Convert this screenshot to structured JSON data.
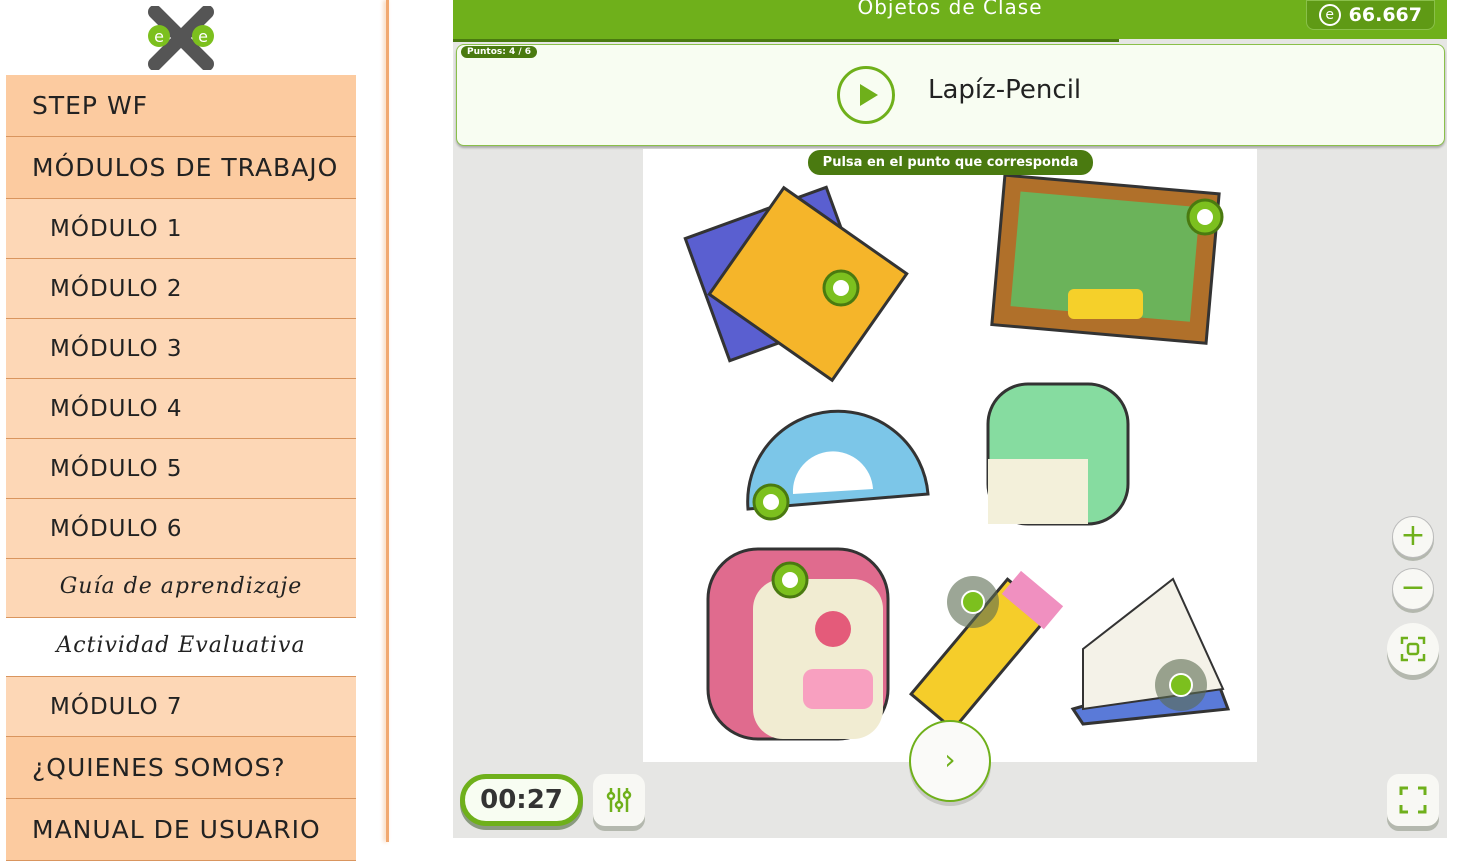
{
  "sidebar": {
    "items": [
      {
        "label": "STEP  WF",
        "kind": "top"
      },
      {
        "label": "MÓDULOS  DE  TRABAJO",
        "kind": "top"
      },
      {
        "label": "MÓDULO  1",
        "kind": "mod"
      },
      {
        "label": "MÓDULO  2",
        "kind": "mod"
      },
      {
        "label": "MÓDULO  3",
        "kind": "mod"
      },
      {
        "label": "MÓDULO  4",
        "kind": "mod"
      },
      {
        "label": "MÓDULO  5",
        "kind": "mod"
      },
      {
        "label": "MÓDULO  6",
        "kind": "mod"
      },
      {
        "label": "Guía  de  aprendizaje",
        "kind": "sub"
      },
      {
        "label": "Actividad  Evaluativa",
        "kind": "sub active"
      },
      {
        "label": "MÓDULO  7",
        "kind": "mod"
      },
      {
        "label": "¿QUIENES  SOMOS?",
        "kind": "top"
      },
      {
        "label": "MANUAL  DE  USUARIO",
        "kind": "top"
      }
    ]
  },
  "game": {
    "title": "Objetos de Clase",
    "score": "66.667",
    "score_icon": "e",
    "points": "Puntos: 4 / 6",
    "word": "Lapíz-Pencil",
    "hint": "Pulsa en el punto que corresponda",
    "timer": "00:27",
    "progress_percent": 67,
    "next": "›",
    "zoom_in": "+",
    "zoom_out": "−"
  },
  "colors": {
    "accent": "#6fb01b",
    "dark": "#4a7a10",
    "sidebar": "#fccba0"
  }
}
